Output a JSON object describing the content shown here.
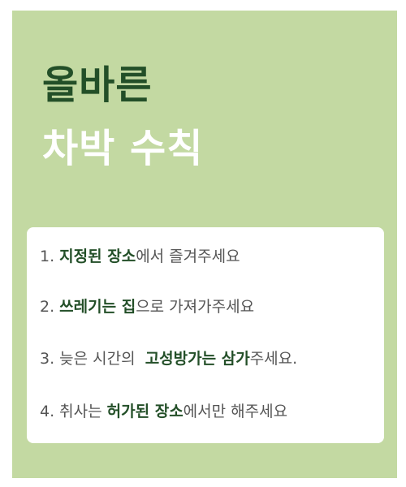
{
  "title": {
    "line1": "올바른",
    "line2": "차박 수칙"
  },
  "rules": [
    {
      "num": "1. ",
      "bold": "지정된 장소",
      "rest": "에서 즐겨주세요"
    },
    {
      "num": "2. ",
      "bold": "쓰레기는 집",
      "rest": "으로 가져가주세요"
    },
    {
      "num": "3. ",
      "pre": "늦은 시간의  ",
      "bold": "고성방가는 삼가",
      "rest": "주세요."
    },
    {
      "num": "4. ",
      "pre": "취사는 ",
      "bold": "허가된 장소",
      "rest": "에서만 해주세요"
    }
  ],
  "colors": {
    "background": "#c3d9a2",
    "accent": "#234f28",
    "panel": "#ffffff",
    "text": "#555555"
  }
}
